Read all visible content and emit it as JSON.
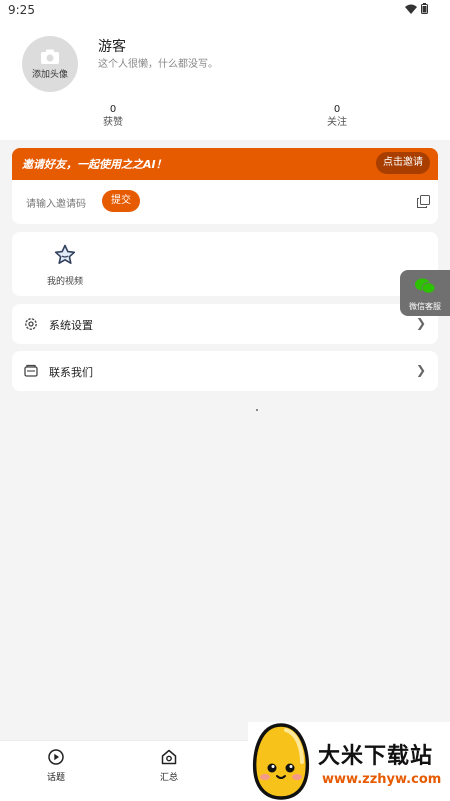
{
  "status_bar": {
    "time": "9:25"
  },
  "profile": {
    "avatar_label": "添加头像",
    "username": "游客",
    "bio": "这个人很懒，什么都没写。",
    "stats": [
      {
        "value": "0",
        "label": "获赞"
      },
      {
        "value": "0",
        "label": "关注"
      }
    ]
  },
  "invite": {
    "banner_text": "邀请好友，一起使用之之AI！",
    "button_label": "点击邀请",
    "code_placeholder": "请输入邀请码",
    "submit_label": "提交"
  },
  "videos": {
    "label": "我的视频"
  },
  "menu": [
    {
      "label": "系统设置",
      "icon": "gear-icon"
    },
    {
      "label": "联系我们",
      "icon": "contact-icon"
    }
  ],
  "wechat": {
    "label": "微信客服"
  },
  "bottom_nav": [
    {
      "label": "话题",
      "icon": "play-icon"
    },
    {
      "label": "汇总",
      "icon": "home-icon"
    }
  ],
  "watermark": {
    "title": "大米下载站",
    "url": "www.zzhyw.com"
  },
  "colors": {
    "accent": "#e65a00",
    "accent_dark": "#a83e00",
    "background": "#f4f4f4"
  }
}
